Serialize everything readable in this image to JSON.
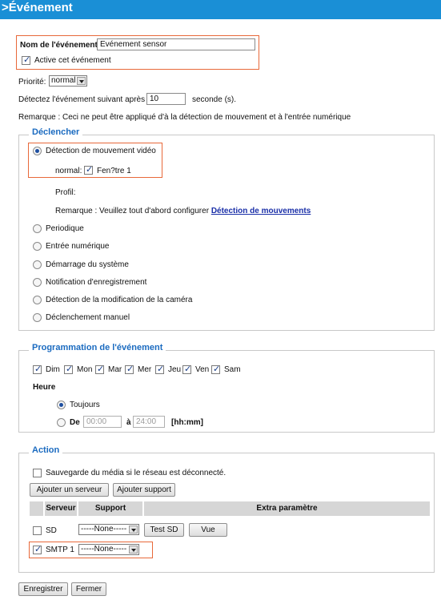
{
  "title": ">Événement",
  "event": {
    "name_label": "Nom de l'événement:",
    "name_value": "Evénement sensor",
    "active_label": "Active cet événement",
    "active_checked": true
  },
  "priority": {
    "label": "Priorité:",
    "value": "normal"
  },
  "detect_next": {
    "prefix": "Détectez l'événement suivant après",
    "value": "10",
    "suffix": "seconde (s)."
  },
  "note_top": "Remarque : Ceci ne peut être appliqué d'à la détection de mouvement et à l'entrée numérique",
  "trigger": {
    "legend": "Déclencher",
    "motion_label": "Détection de mouvement vidéo",
    "normal_label": "normal:",
    "window_label": "Fen?tre 1",
    "profile_label": "Profil:",
    "remark_prefix": "Remarque : Veuillez tout d'abord configurer",
    "remark_link": "Détection de mouvements",
    "options": [
      "Periodique",
      "Entrée numérique",
      "Démarrage du système",
      "Notification d'enregistrement",
      "Détection de la modification de la caméra",
      "Déclenchement manuel"
    ]
  },
  "schedule": {
    "legend": "Programmation de l'événement",
    "days": [
      "Dim",
      "Mon",
      "Mar",
      "Mer",
      "Jeu",
      "Ven",
      "Sam"
    ],
    "time_label": "Heure",
    "always_label": "Toujours",
    "from_label": "De",
    "from_value": "00:00",
    "to_label": "à",
    "to_value": "24:00",
    "format_label": "[hh:mm]"
  },
  "action": {
    "legend": "Action",
    "backup_label": "Sauvegarde du média si le réseau est déconnecté.",
    "add_server_button": "Ajouter un serveur",
    "add_support_button": "Ajouter support",
    "headers": [
      "Serveur",
      "Support",
      "Extra paramètre"
    ],
    "rows": [
      {
        "server": "SD",
        "support": "-----None-----",
        "checked": false,
        "buttons": [
          "Test SD",
          "Vue"
        ]
      },
      {
        "server": "SMTP 1",
        "support": "-----None-----",
        "checked": true,
        "buttons": []
      }
    ]
  },
  "footer": {
    "save_button": "Enregistrer",
    "close_button": "Fermer"
  },
  "colors": {
    "title_bar": "#1a8fd6",
    "highlight_border": "#e8693a",
    "legend_text": "#1b6bc0",
    "link": "#1a2fa8"
  }
}
